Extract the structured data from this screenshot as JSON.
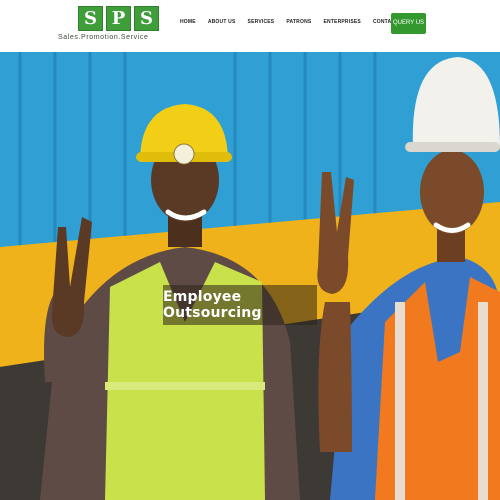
{
  "header": {
    "logo_letters": [
      "S",
      "P",
      "S"
    ],
    "logo_tagline": "Sales.Promotion.Service",
    "nav": [
      "HOME",
      "ABOUT US",
      "SERVICES",
      "PATRONS",
      "ENTERPRISES",
      "CONTACT"
    ],
    "query_label": "QUERY US"
  },
  "hero": {
    "caption": "Employee Outsourcing",
    "image_description_icon": "hero-workers-photo"
  },
  "colors": {
    "brand_green": "#3f9d3a",
    "button_green": "#33992e",
    "container_blue": "#2f9fd4",
    "container_yellow": "#f0b21a"
  }
}
